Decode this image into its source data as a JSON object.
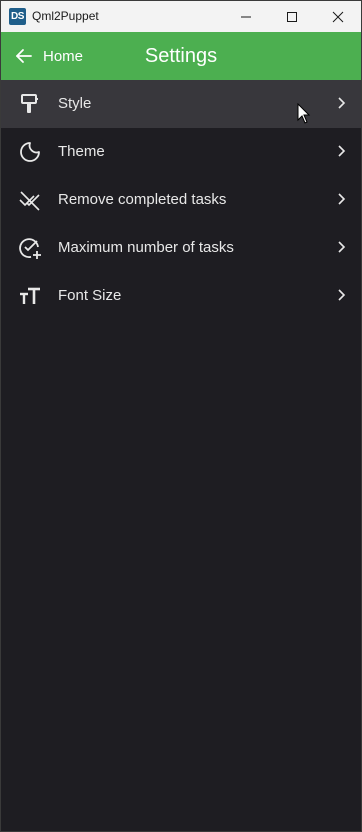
{
  "window": {
    "app_icon_text": "DS",
    "title": "Qml2Puppet"
  },
  "header": {
    "back_label": "Home",
    "title": "Settings",
    "accent_color": "#4caf50"
  },
  "settings_items": [
    {
      "label": "Style",
      "icon": "paint-roller-icon"
    },
    {
      "label": "Theme",
      "icon": "moon-icon"
    },
    {
      "label": "Remove completed tasks",
      "icon": "remove-done-icon"
    },
    {
      "label": "Maximum number of tasks",
      "icon": "add-task-icon"
    },
    {
      "label": "Font Size",
      "icon": "text-size-icon"
    }
  ],
  "colors": {
    "background": "#1e1d22",
    "hover_row": "#38373c",
    "text": "#e8e8e8"
  }
}
